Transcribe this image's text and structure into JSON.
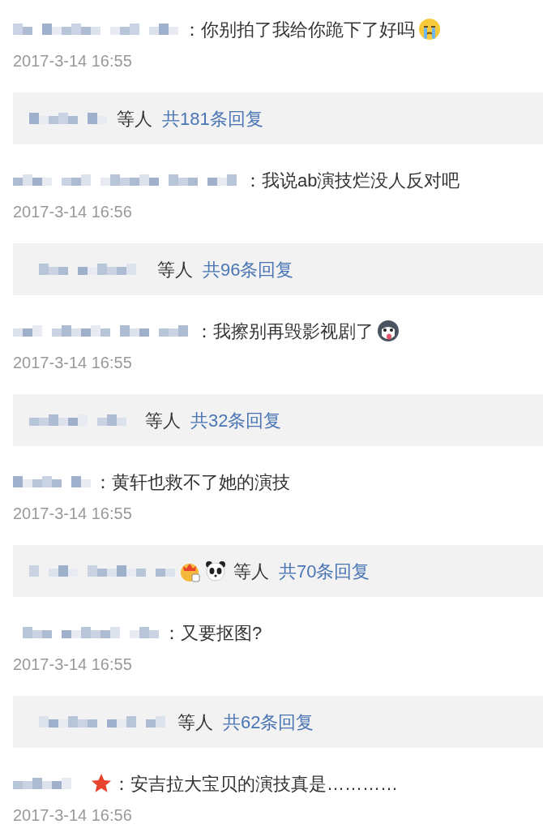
{
  "comments": [
    {
      "separator": "：",
      "text": "你别拍了我给你跪下了好吗",
      "trailing_icon": {
        "kind": "crying"
      },
      "time": "2017-3-14 16:55",
      "reply": {
        "suffix": "等人",
        "count": "共181条回复"
      }
    },
    {
      "separator": "：",
      "text": "我说ab演技烂没人反对吧",
      "time": "2017-3-14 16:56",
      "reply": {
        "suffix": "等人",
        "count": "共96条回复"
      }
    },
    {
      "separator": "：",
      "text": "我擦别再毁影视剧了",
      "trailing_icon": {
        "kind": "dog"
      },
      "time": "2017-3-14 16:55",
      "reply": {
        "suffix": "等人",
        "count": "共32条回复"
      }
    },
    {
      "separator": "：",
      "text": "黄轩也救不了她的演技",
      "time": "2017-3-14 16:55",
      "reply": {
        "suffix": "等人",
        "count": "共70条回复",
        "icons": [
          {
            "kind": "crown"
          },
          {
            "kind": "panda"
          }
        ]
      }
    },
    {
      "separator": "：",
      "text": "又要抠图?",
      "time": "2017-3-14 16:55",
      "reply": {
        "suffix": "等人",
        "count": "共62条回复"
      }
    },
    {
      "separator": "：",
      "text": "安吉拉大宝贝的演技真是…………",
      "name_badge": {
        "kind": "star"
      },
      "time": "2017-3-14 16:56"
    }
  ]
}
